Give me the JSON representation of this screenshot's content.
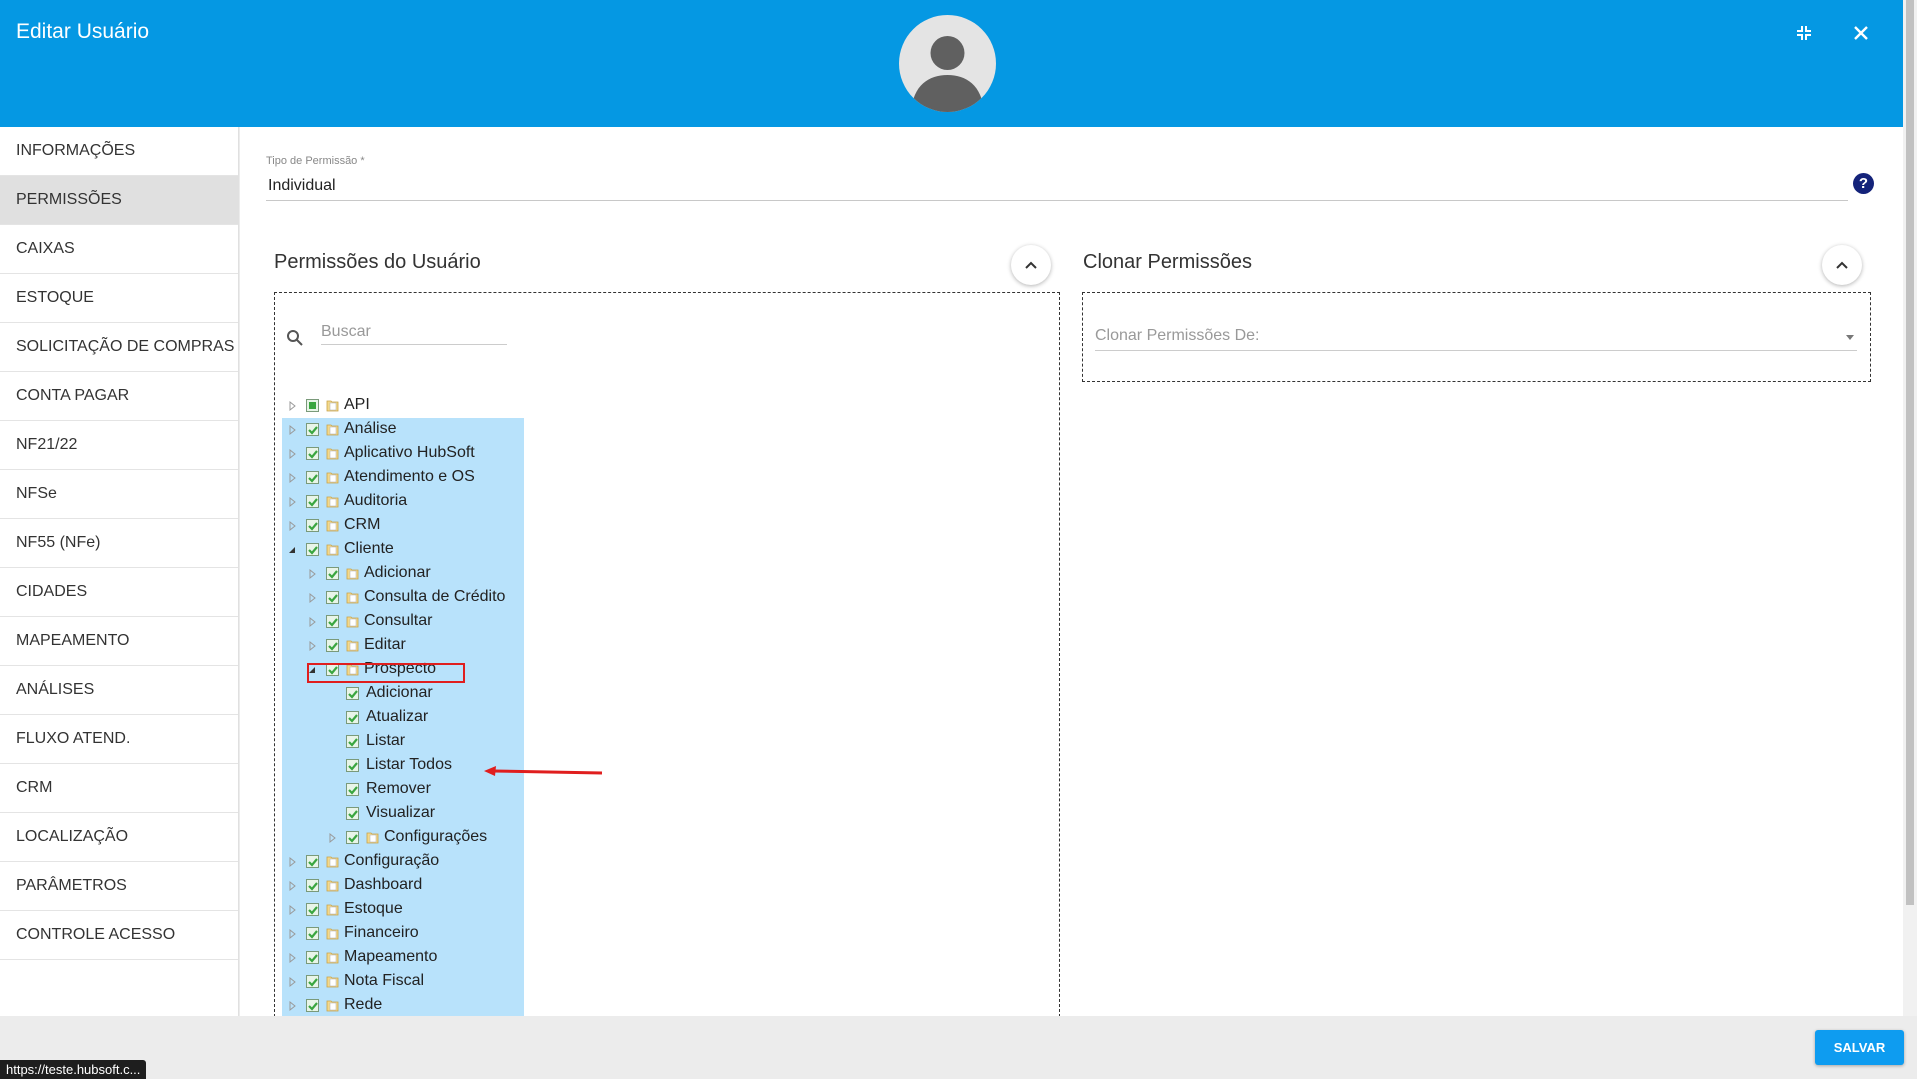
{
  "header": {
    "title": "Editar Usuário"
  },
  "sidebar": {
    "items": [
      {
        "label": "INFORMAÇÕES"
      },
      {
        "label": "PERMISSÕES",
        "active": true
      },
      {
        "label": "CAIXAS"
      },
      {
        "label": "ESTOQUE"
      },
      {
        "label": "SOLICITAÇÃO DE COMPRAS"
      },
      {
        "label": "CONTA PAGAR"
      },
      {
        "label": "NF21/22"
      },
      {
        "label": "NFSe"
      },
      {
        "label": "NF55 (NFe)"
      },
      {
        "label": "CIDADES"
      },
      {
        "label": "MAPEAMENTO"
      },
      {
        "label": "ANÁLISES"
      },
      {
        "label": "FLUXO ATEND."
      },
      {
        "label": "CRM"
      },
      {
        "label": "LOCALIZAÇÃO"
      },
      {
        "label": "PARÂMETROS"
      },
      {
        "label": "CONTROLE ACESSO"
      }
    ]
  },
  "permission_type": {
    "label": "Tipo de Permissão *",
    "value": "Individual"
  },
  "user_permissions": {
    "title": "Permissões do Usuário",
    "search_placeholder": "Buscar",
    "tree": [
      {
        "label": "API",
        "level": 0,
        "expander": "collapsed",
        "check": "partial",
        "folder": true,
        "selected": false
      },
      {
        "label": "Análise",
        "level": 0,
        "expander": "collapsed",
        "check": "checked",
        "folder": true,
        "selected": true
      },
      {
        "label": "Aplicativo HubSoft",
        "level": 0,
        "expander": "collapsed",
        "check": "checked",
        "folder": true,
        "selected": true
      },
      {
        "label": "Atendimento e OS",
        "level": 0,
        "expander": "collapsed",
        "check": "checked",
        "folder": true,
        "selected": true
      },
      {
        "label": "Auditoria",
        "level": 0,
        "expander": "collapsed",
        "check": "checked",
        "folder": true,
        "selected": true
      },
      {
        "label": "CRM",
        "level": 0,
        "expander": "collapsed",
        "check": "checked",
        "folder": true,
        "selected": true
      },
      {
        "label": "Cliente",
        "level": 0,
        "expander": "expanded",
        "check": "checked",
        "folder": true,
        "selected": true
      },
      {
        "label": "Adicionar",
        "level": 1,
        "expander": "collapsed",
        "check": "checked",
        "folder": true,
        "selected": true
      },
      {
        "label": "Consulta de Crédito",
        "level": 1,
        "expander": "collapsed",
        "check": "checked",
        "folder": true,
        "selected": true
      },
      {
        "label": "Consultar",
        "level": 1,
        "expander": "collapsed",
        "check": "checked",
        "folder": true,
        "selected": true
      },
      {
        "label": "Editar",
        "level": 1,
        "expander": "collapsed",
        "check": "checked",
        "folder": true,
        "selected": true
      },
      {
        "label": "Prospecto",
        "level": 1,
        "expander": "expanded",
        "check": "checked",
        "folder": true,
        "selected": true
      },
      {
        "label": "Adicionar",
        "level": 2,
        "expander": "none",
        "check": "checked",
        "folder": false,
        "selected": true
      },
      {
        "label": "Atualizar",
        "level": 2,
        "expander": "none",
        "check": "checked",
        "folder": false,
        "selected": true
      },
      {
        "label": "Listar",
        "level": 2,
        "expander": "none",
        "check": "checked",
        "folder": false,
        "selected": true
      },
      {
        "label": "Listar Todos",
        "level": 2,
        "expander": "none",
        "check": "checked",
        "folder": false,
        "selected": true
      },
      {
        "label": "Remover",
        "level": 2,
        "expander": "none",
        "check": "checked",
        "folder": false,
        "selected": true
      },
      {
        "label": "Visualizar",
        "level": 2,
        "expander": "none",
        "check": "checked",
        "folder": false,
        "selected": true
      },
      {
        "label": "Configurações",
        "level": 2,
        "expander": "collapsed",
        "check": "checked",
        "folder": true,
        "selected": true
      },
      {
        "label": "Configuração",
        "level": 0,
        "expander": "collapsed",
        "check": "checked",
        "folder": true,
        "selected": true
      },
      {
        "label": "Dashboard",
        "level": 0,
        "expander": "collapsed",
        "check": "checked",
        "folder": true,
        "selected": true
      },
      {
        "label": "Estoque",
        "level": 0,
        "expander": "collapsed",
        "check": "checked",
        "folder": true,
        "selected": true
      },
      {
        "label": "Financeiro",
        "level": 0,
        "expander": "collapsed",
        "check": "checked",
        "folder": true,
        "selected": true
      },
      {
        "label": "Mapeamento",
        "level": 0,
        "expander": "collapsed",
        "check": "checked",
        "folder": true,
        "selected": true
      },
      {
        "label": "Nota Fiscal",
        "level": 0,
        "expander": "collapsed",
        "check": "checked",
        "folder": true,
        "selected": true
      },
      {
        "label": "Rede",
        "level": 0,
        "expander": "collapsed",
        "check": "checked",
        "folder": true,
        "selected": true
      }
    ]
  },
  "clone_permissions": {
    "title": "Clonar Permissões",
    "placeholder": "Clonar Permissões De:"
  },
  "footer": {
    "save_label": "SALVAR"
  },
  "status_bar": {
    "url": "https://teste.hubsoft.c..."
  },
  "colors": {
    "header": "#0598e3",
    "selected_row": "#b8e2fb",
    "check_green": "#3aa640",
    "annotation_red": "#e01e1e",
    "help_icon": "#14237a",
    "save_button": "#0e9cf0"
  },
  "icons": {
    "search": "search-icon",
    "close": "close-icon",
    "minimize": "minimize-icon",
    "help": "help-icon",
    "collapse": "chevron-up-icon",
    "folder": "folder-icon",
    "avatar": "avatar-icon"
  }
}
